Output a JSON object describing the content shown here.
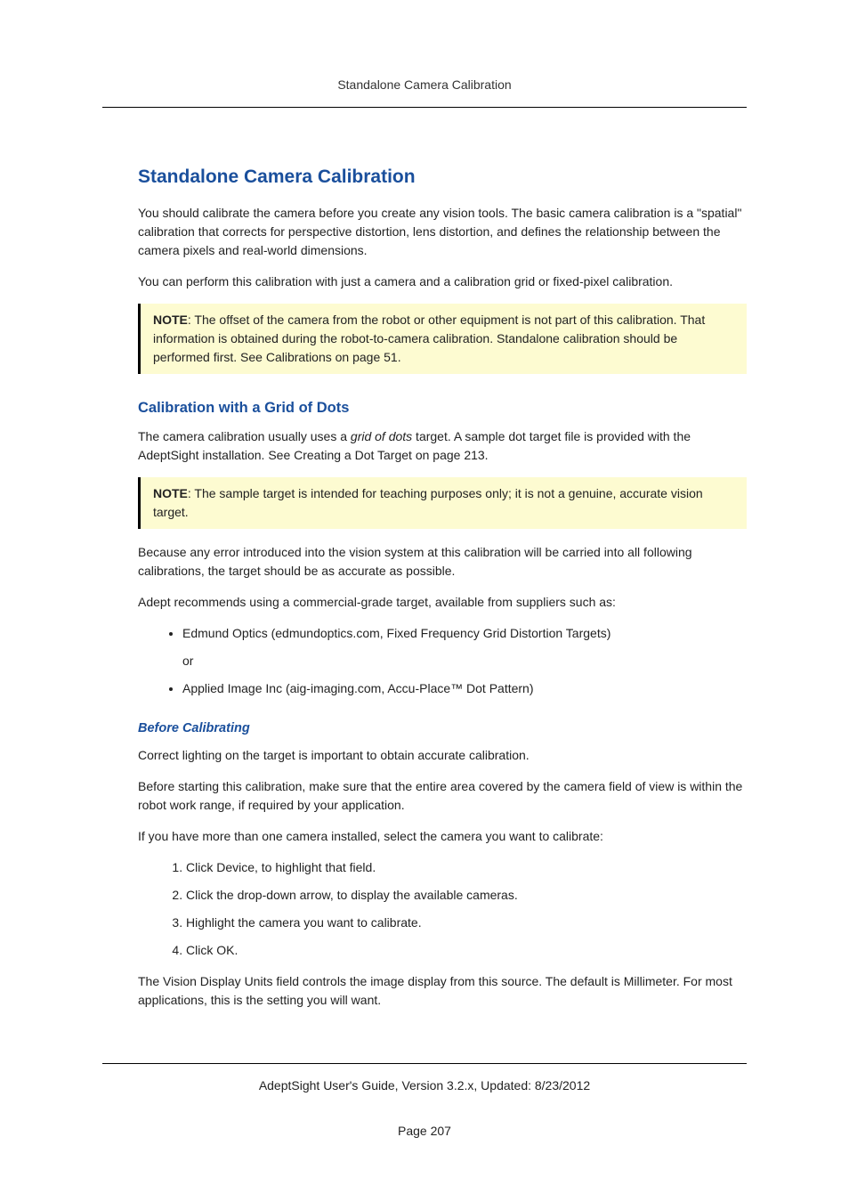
{
  "header": {
    "running": "Standalone Camera Calibration"
  },
  "title": "Standalone Camera Calibration",
  "intro_p1": "You should calibrate the camera before you create any vision tools. The basic camera calibration is a \"spatial\" calibration that corrects for perspective distortion, lens distortion, and defines the relationship between the camera pixels and real-world dimensions.",
  "intro_p2": "You can perform this calibration with just a camera and a calibration grid or fixed-pixel calibration.",
  "note1": {
    "label": "NOTE",
    "text": ": The offset of the camera from the robot or other equipment is not part of this calibration. That information is obtained during the robot-to-camera calibration. Standalone calibration should be performed first. See Calibrations on page 51."
  },
  "section_grid": {
    "heading": "Calibration with a Grid of Dots",
    "p1_a": "The camera calibration usually uses a ",
    "p1_em": "grid of dots",
    "p1_b": " target. A sample dot target file is provided with the AdeptSight installation. See Creating a Dot Target on page 213.",
    "note": {
      "label": "NOTE",
      "text": ": The sample target is intended for teaching purposes only; it is not a genuine, accurate vision target."
    },
    "p2": "Because any error introduced into the vision system at this calibration will be carried into all following calibrations, the target should be as accurate as possible.",
    "p3": "Adept recommends using a commercial-grade target, available from suppliers such as:",
    "bullets": [
      "Edmund Optics (edmundoptics.com, Fixed Frequency Grid Distortion Targets)",
      "or",
      "Applied Image Inc (aig-imaging.com, Accu-Place™ Dot Pattern)"
    ]
  },
  "section_before": {
    "heading": "Before Calibrating",
    "p1": "Correct lighting on the target is important to obtain accurate calibration.",
    "p2": "Before starting this calibration, make sure that the entire area covered by the camera field of view is within the robot work range, if required by your application.",
    "p3": "If you have more than one camera installed, select the camera you want to calibrate:",
    "steps": [
      "Click Device, to highlight that field.",
      "Click the drop-down arrow, to display the available cameras.",
      "Highlight the camera you want to calibrate.",
      "Click OK."
    ],
    "p4": "The Vision Display Units field controls the image display from this source. The default is Millimeter. For most applications, this is the setting you will want."
  },
  "footer": {
    "line": "AdeptSight User's Guide,  Version 3.2.x, Updated: 8/23/2012",
    "page": "Page 207"
  }
}
